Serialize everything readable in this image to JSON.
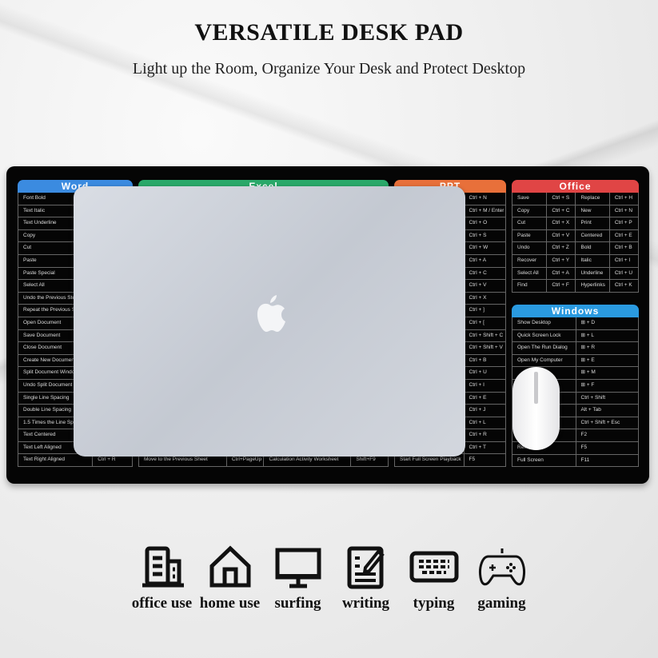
{
  "title": "VERSATILE DESK PAD",
  "subtitle": "Light up the Room, Organize Your Desk and Protect Desktop",
  "colors": {
    "word": "#3b8be0",
    "excel": "#2aa96a",
    "ppt": "#e8703a",
    "office": "#e04545",
    "windows": "#2a9ae0",
    "pad": "#050505"
  },
  "panels": {
    "word": {
      "title": "Word",
      "rows": [
        [
          "Font Bold",
          ""
        ],
        [
          "Text Italic",
          ""
        ],
        [
          "Text Underline",
          ""
        ],
        [
          "Copy",
          ""
        ],
        [
          "Cut",
          ""
        ],
        [
          "Paste",
          ""
        ],
        [
          "Paste Special",
          ""
        ],
        [
          "Select All",
          ""
        ],
        [
          "Undo the Previous Ste",
          ""
        ],
        [
          "Repeat the Previous S",
          ""
        ],
        [
          "Open Document",
          ""
        ],
        [
          "Save Document",
          ""
        ],
        [
          "Close Document",
          ""
        ],
        [
          "Create New Document",
          ""
        ],
        [
          "Split Document Windo",
          ""
        ],
        [
          "Undo Split Document V",
          ""
        ],
        [
          "Single Line Spacing",
          ""
        ],
        [
          "Double Line Spacing",
          ""
        ],
        [
          "1.5 Times the Line Spac",
          ""
        ],
        [
          "Text Centered",
          ""
        ],
        [
          "Text Left Aligned",
          ""
        ],
        [
          "Text Right Aligned",
          "Ctrl + R"
        ]
      ]
    },
    "excel": {
      "title": "Excel",
      "last": [
        "Move to the Previous Sheet",
        "Ctrl+PageUp",
        "Calculation Activity Worksheet",
        "Shift+F9"
      ]
    },
    "ppt": {
      "title": "PPT",
      "keys": [
        "Ctrl + N",
        "Ctrl + M / Enter",
        "Ctrl + O",
        "Ctrl + S",
        "Ctrl + W",
        "Ctrl + A",
        "Ctrl + C",
        "Ctrl + V",
        "Ctrl + X",
        "Ctrl + ]",
        "Ctrl + [",
        "Ctrl + Shift + C",
        "Ctrl + Shift + V",
        "Ctrl + B",
        "Ctrl + U",
        "Ctrl + I",
        "Ctrl + E",
        "Ctrl + J",
        "Ctrl + L",
        "Ctrl + R",
        "Ctrl + T",
        "F5"
      ],
      "last_label": "Start Full Screen Playback"
    },
    "office": {
      "title": "Office",
      "rows": [
        [
          "Save",
          "Ctrl + S",
          "Replace",
          "Ctrl + H"
        ],
        [
          "Copy",
          "Ctrl + C",
          "New",
          "Ctrl + N"
        ],
        [
          "Cut",
          "Ctrl + X",
          "Print",
          "Ctrl + P"
        ],
        [
          "Paste",
          "Ctrl + V",
          "Centered",
          "Ctrl + E"
        ],
        [
          "Undo",
          "Ctrl + Z",
          "Bold",
          "Ctrl + B"
        ],
        [
          "Recover",
          "Ctrl + Y",
          "Italic",
          "Ctrl + I"
        ],
        [
          "Select All",
          "Ctrl + A",
          "Underline",
          "Ctrl + U"
        ],
        [
          "Find",
          "Ctrl + F",
          "Hyperlinks",
          "Ctrl + K"
        ]
      ]
    },
    "windows": {
      "title": "Windows",
      "rows": [
        [
          "Show Desktop",
          "⊞ + D"
        ],
        [
          "Quick Screen Lock",
          "⊞ + L"
        ],
        [
          "Open The Run Dialog",
          "⊞ + R"
        ],
        [
          "Open My Computer",
          "⊞ + E"
        ],
        [
          "",
          "⊞ + M"
        ],
        [
          "",
          "⊞ + F"
        ],
        [
          "",
          "Ctrl + Shift"
        ],
        [
          "",
          "Alt + Tab"
        ],
        [
          "",
          "Ctrl + Shift + Esc"
        ],
        [
          "",
          "F2"
        ],
        [
          "Refresh",
          "F5"
        ],
        [
          "Full Screen",
          "F11"
        ]
      ]
    }
  },
  "uses": [
    {
      "label": "office use",
      "icon": "office-building-icon"
    },
    {
      "label": "home use",
      "icon": "house-icon"
    },
    {
      "label": "surfing",
      "icon": "monitor-icon"
    },
    {
      "label": "writing",
      "icon": "document-pen-icon"
    },
    {
      "label": "typing",
      "icon": "keyboard-icon"
    },
    {
      "label": "gaming",
      "icon": "gamepad-icon"
    }
  ]
}
